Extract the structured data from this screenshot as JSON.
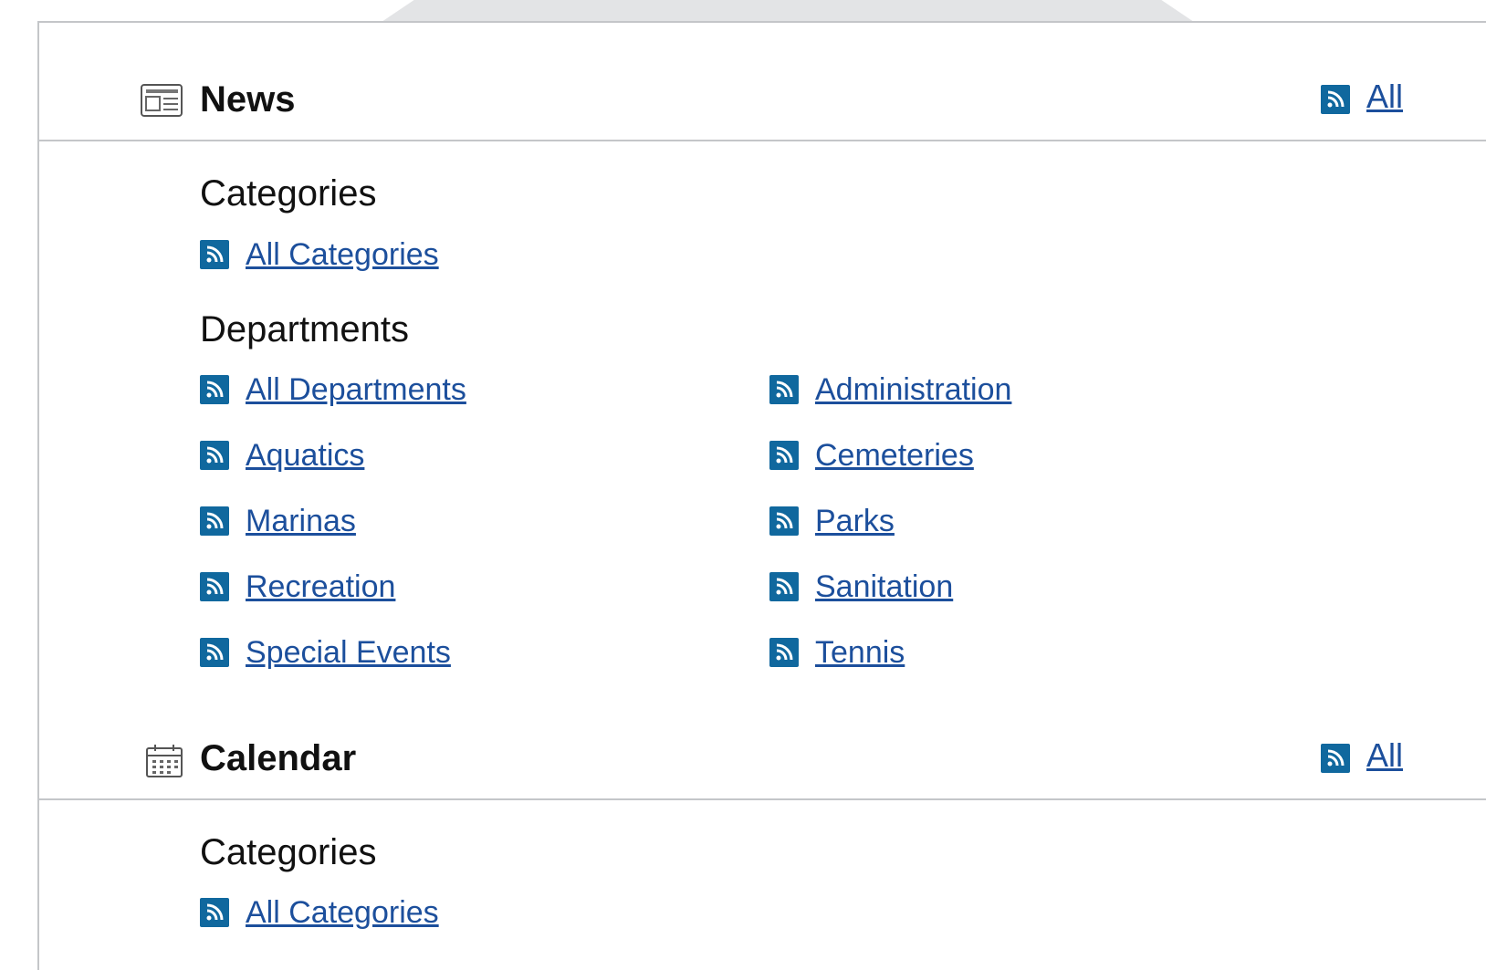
{
  "news": {
    "title": "News",
    "all_label": "All",
    "groups": [
      {
        "title": "Categories",
        "items": [
          "All Categories"
        ]
      },
      {
        "title": "Departments",
        "items": [
          "All Departments",
          "Administration",
          "Aquatics",
          "Cemeteries",
          "Marinas",
          "Parks",
          "Recreation",
          "Sanitation",
          "Special Events",
          "Tennis"
        ]
      }
    ]
  },
  "calendar": {
    "title": "Calendar",
    "all_label": "All",
    "groups": [
      {
        "title": "Categories",
        "items": [
          "All Categories"
        ]
      }
    ]
  },
  "colors": {
    "link": "#1c4f9c",
    "rss_bg": "#10689e",
    "border": "#c4c6c9"
  },
  "icons": {
    "news": "newspaper-icon",
    "calendar": "calendar-icon",
    "feed": "rss-icon"
  }
}
